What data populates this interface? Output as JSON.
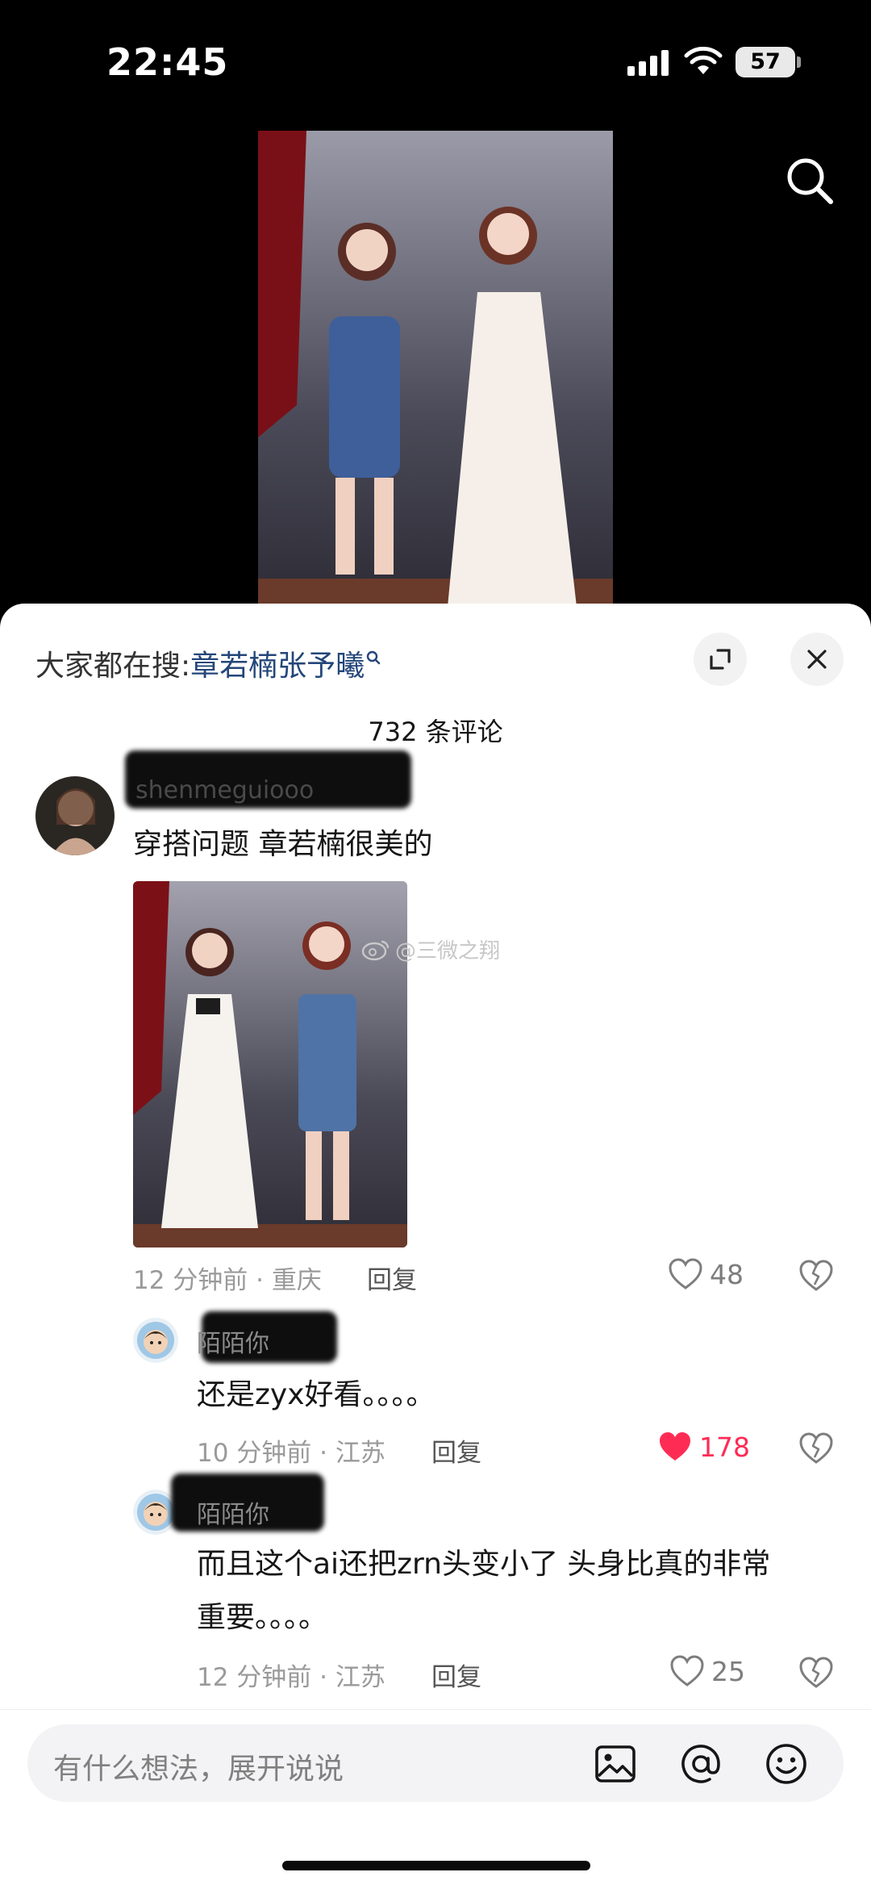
{
  "status_bar": {
    "time": "22:45",
    "battery": "57"
  },
  "hot_search": {
    "prefix": "大家都在搜:",
    "term": "章若楠张予曦"
  },
  "comments_header": {
    "count_text": "732 条评论"
  },
  "comments": [
    {
      "username": "shenmeguiooo",
      "text": "穿搭问题 章若楠很美的",
      "time_location": "12 分钟前 · 重庆",
      "reply_label": "回复",
      "likes": "48",
      "liked": false,
      "image_watermark": "@三微之翔"
    }
  ],
  "replies": [
    {
      "username": "陌陌你",
      "text": "还是zyx好看。。。。",
      "time_location": "10 分钟前 · 江苏",
      "reply_label": "回复",
      "likes": "178",
      "liked": true
    },
    {
      "username": "陌陌你",
      "text_line1": "而且这个ai还把zrn头变小了 头身比真的非常",
      "text_line2": "重要。。。。",
      "time_location": "12 分钟前 · 江苏",
      "reply_label": "回复",
      "likes": "25",
      "liked": false
    }
  ],
  "input": {
    "placeholder": "有什么想法，展开说说"
  },
  "colors": {
    "accent_like": "#fe2c55",
    "hot_term": "#24467a"
  },
  "icons": [
    "search-icon",
    "expand-icon",
    "close-icon",
    "heart-icon",
    "broken-heart-icon",
    "image-icon",
    "at-icon",
    "emoji-icon"
  ]
}
